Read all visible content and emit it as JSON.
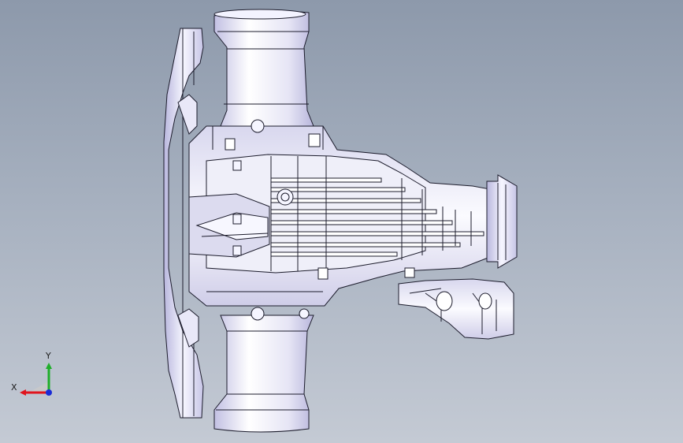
{
  "viewport": {
    "background_top": "#8d99ab",
    "background_bottom": "#c4cad4",
    "model_fill": "#eeeef7",
    "model_shade": "#c9c8e4",
    "edge_color": "#1c1c2c"
  },
  "triad": {
    "x_label": "X",
    "y_label": "Y",
    "x_color": "#e0141e",
    "y_color": "#1fae2a",
    "z_color": "#1a2bd6"
  }
}
